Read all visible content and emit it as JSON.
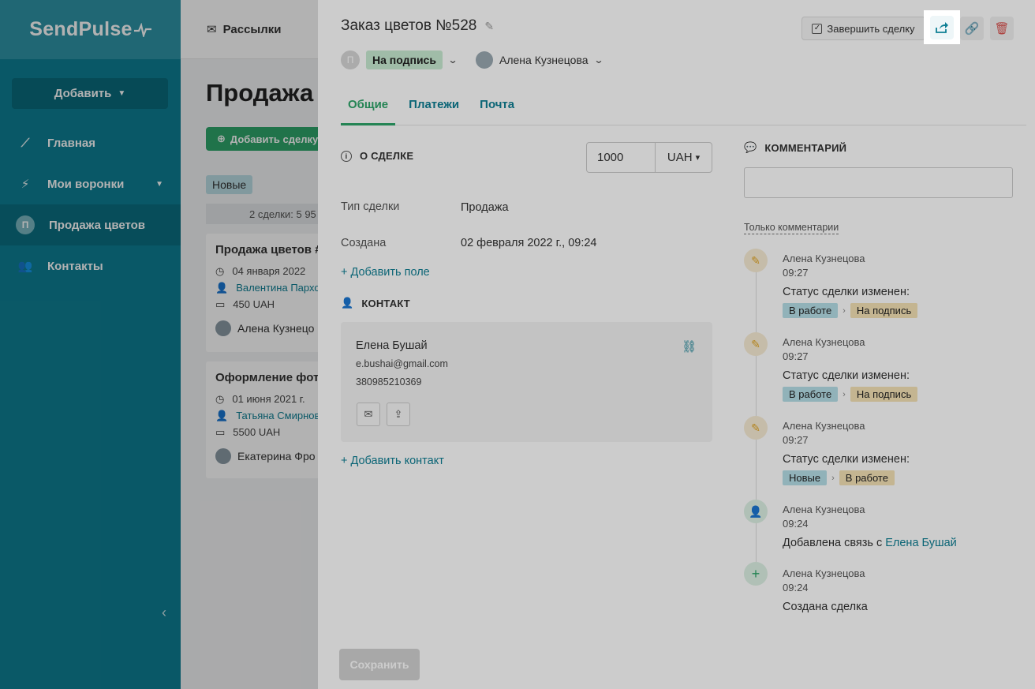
{
  "sidebar": {
    "logo": "SendPulse",
    "add_label": "Добавить",
    "items": [
      {
        "label": "Главная",
        "icon": "chart-line-icon"
      },
      {
        "label": "Мои воронки",
        "icon": "funnel-icon"
      },
      {
        "label": "Продажа цветов",
        "avatar": "П"
      },
      {
        "label": "Контакты",
        "icon": "contacts-icon"
      }
    ]
  },
  "background": {
    "top_nav": "Рассылки",
    "page_title": "Продажа",
    "add_deal": "Добавить сделку",
    "stage": "Новые",
    "summary": "2 сделки: 5 95",
    "cards": [
      {
        "title": "Продажа цветов #",
        "date": "04 января 2022",
        "contact": "Валентина Пархо",
        "amount": "450 UAH",
        "owner": "Алена Кузнецо"
      },
      {
        "title": "Оформление фото",
        "date": "01 июня 2021 г.",
        "contact": "Татьяна Смирнов",
        "amount": "5500 UAH",
        "owner": "Екатерина Фро"
      }
    ]
  },
  "deal": {
    "title": "Заказ цветов №528",
    "status_avatar": "П",
    "status": "На подпись",
    "owner": "Алена Кузнецова",
    "finish_label": "Завершить сделку",
    "tabs": [
      "Общие",
      "Платежи",
      "Почта"
    ],
    "about_header": "О СДЕЛКЕ",
    "amount": "1000",
    "currency": "UAH",
    "fields": [
      {
        "label": "Тип сделки",
        "value": "Продажа"
      },
      {
        "label": "Создана",
        "value": "02 февраля 2022 г., 09:24"
      }
    ],
    "add_field": "+ Добавить поле",
    "contact_header": "КОНТАКТ",
    "contact": {
      "name": "Елена Бушай",
      "email": "e.bushai@gmail.com",
      "phone": "380985210369"
    },
    "add_contact": "+ Добавить контакт",
    "save_label": "Сохранить"
  },
  "comments": {
    "header": "КОММЕНТАРИЙ",
    "filter": "Только комментарии",
    "events": [
      {
        "author": "Алена Кузнецова",
        "time": "09:27",
        "text": "Статус сделки изменен:",
        "from": "В работе",
        "to": "На подпись"
      },
      {
        "author": "Алена Кузнецова",
        "time": "09:27",
        "text": "Статус сделки изменен:",
        "from": "В работе",
        "to": "На подпись"
      },
      {
        "author": "Алена Кузнецова",
        "time": "09:27",
        "text": "Статус сделки изменен:",
        "from": "Новые",
        "to": "В работе"
      },
      {
        "author": "Алена Кузнецова",
        "time": "09:24",
        "text": "Добавлена связь с ",
        "link": "Елена Бушай"
      },
      {
        "author": "Алена Кузнецова",
        "time": "09:24",
        "text": "Создана сделка"
      }
    ]
  }
}
